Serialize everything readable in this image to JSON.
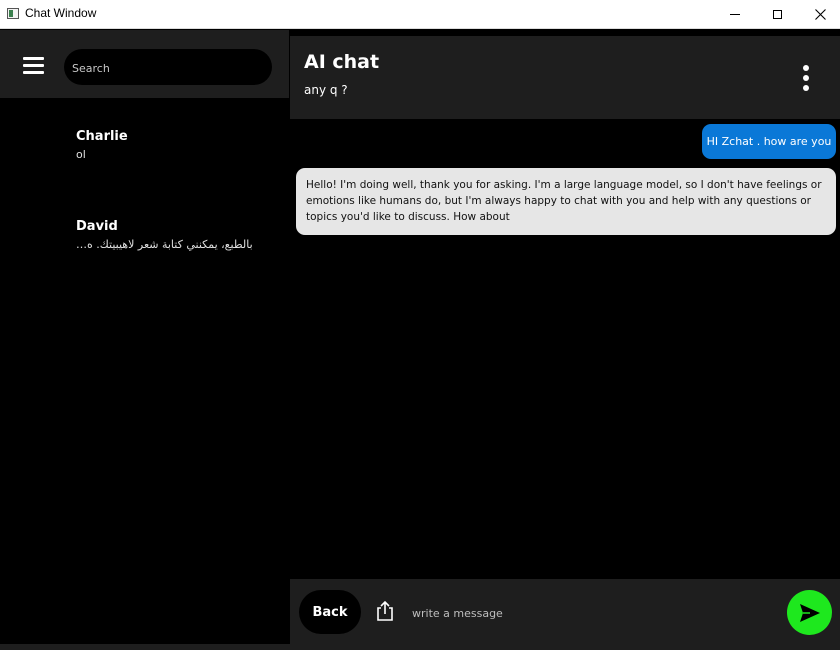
{
  "window": {
    "title": "Chat Window",
    "minimize_label": "minimize",
    "maximize_label": "maximize",
    "close_label": "close"
  },
  "sidebar": {
    "search_placeholder": "Search",
    "contacts": [
      {
        "name": "Charlie",
        "preview": "ol"
      },
      {
        "name": "David",
        "preview": "بالطبع، يمكنني كتابة شعر لاهيبيتك. ه…"
      }
    ]
  },
  "chat": {
    "title": "AI chat",
    "subtitle": "any q ?",
    "messages": [
      {
        "from": "me",
        "text": "HI Zchat . how are you"
      },
      {
        "from": "ai",
        "text": "Hello! I'm doing well, thank you for asking. I'm a large language model, so I don't have feelings or emotions like humans do, but I'm always happy to chat with you and help with any questions or topics you'd like to discuss. How about"
      }
    ]
  },
  "composer": {
    "back_label": "Back",
    "placeholder": "write a message"
  },
  "colors": {
    "accent_outgoing": "#0a78d7",
    "send_button": "#1ee81e",
    "panel": "#1e1e1e"
  }
}
